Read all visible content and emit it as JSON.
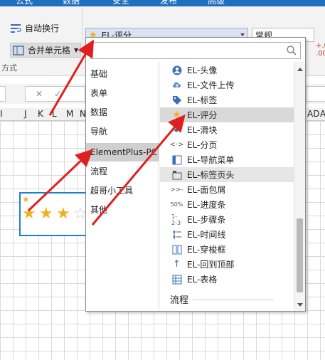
{
  "ribbon_tabs": [
    "公式",
    "数据",
    "安全",
    "发布",
    "高级"
  ],
  "ribbon": {
    "wrap_label": "自动换行",
    "merge_label": "合并单元格",
    "group_caption": "方式",
    "rate_combo_value": "EL-评分",
    "format_combo_value": "常规"
  },
  "columns": [
    "I",
    "J",
    "K",
    "L",
    "M",
    "N",
    "AD",
    "A"
  ],
  "popup": {
    "categories": [
      "基础",
      "表单",
      "数据",
      "导航",
      "ElementPlus-PC",
      "流程",
      "超哥小工具",
      "其他"
    ],
    "active_category": "ElementPlus-PC",
    "items": [
      {
        "label": "EL-头像",
        "icon": "avatar-icon"
      },
      {
        "label": "EL-文件上传",
        "icon": "upload-icon"
      },
      {
        "label": "EL-标签",
        "icon": "tag-icon"
      },
      {
        "label": "EL-评分",
        "icon": "rate-star-icon"
      },
      {
        "label": "EL-滑块",
        "icon": "slider-icon"
      },
      {
        "label": "EL-分页",
        "icon": "pagination-icon"
      },
      {
        "label": "EL-导航菜单",
        "icon": "menu-icon"
      },
      {
        "label": "EL-标签页头",
        "icon": "tabs-icon"
      },
      {
        "label": "EL-面包屑",
        "icon": "breadcrumb-icon"
      },
      {
        "label": "EL-进度条",
        "icon": "progress-icon"
      },
      {
        "label": "EL-步骤条",
        "icon": "steps-icon"
      },
      {
        "label": "EL-时间线",
        "icon": "timeline-icon"
      },
      {
        "label": "EL-穿梭框",
        "icon": "transfer-icon"
      },
      {
        "label": "EL-回到顶部",
        "icon": "backtop-icon"
      },
      {
        "label": "EL-表格",
        "icon": "table-icon"
      }
    ],
    "selected_item": "EL-评分",
    "section_label": "流程",
    "icon_glyphs": {
      "breadcrumb": ">>-",
      "progress": "50%",
      "steps": "1-2-3"
    }
  },
  "rating_cell": {
    "filled_stars": 3,
    "total_stars": 4
  },
  "colors": {
    "accent_blue": "#1e6fc0",
    "arrow_red": "#e02020",
    "star_gold": "#f2b01e"
  }
}
